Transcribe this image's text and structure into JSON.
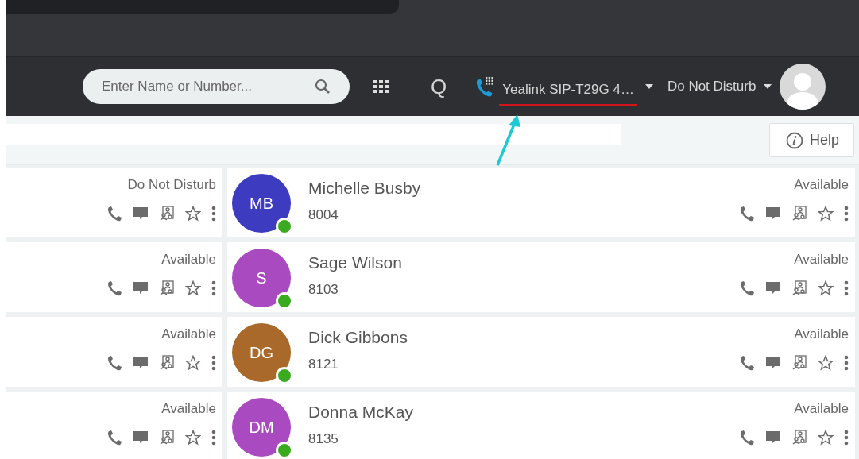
{
  "header": {
    "search": {
      "placeholder": "Enter Name or Number..."
    },
    "q_label": "Q",
    "device": {
      "label": "Yealink SIP-T29G 4…"
    },
    "status_menu": {
      "label": "Do Not Disturb"
    }
  },
  "help_button": {
    "label": "Help"
  },
  "rows": [
    {
      "left": {
        "status": "Do Not Disturb"
      },
      "right": {
        "avatar": {
          "initials": "MB",
          "color": "#3d3bbf"
        },
        "presence": {
          "color": "#3aaa1f"
        },
        "name": "Michelle Busby",
        "extension": "8004",
        "status": "Available"
      }
    },
    {
      "left": {
        "status": "Available"
      },
      "right": {
        "avatar": {
          "initials": "S",
          "color": "#a94ac0"
        },
        "presence": {
          "color": "#3aaa1f"
        },
        "name": "Sage Wilson",
        "extension": "8103",
        "status": "Available"
      }
    },
    {
      "left": {
        "status": "Available"
      },
      "right": {
        "avatar": {
          "initials": "DG",
          "color": "#a8692a"
        },
        "presence": {
          "color": "#3aaa1f"
        },
        "name": "Dick Gibbons",
        "extension": "8121",
        "status": "Available"
      }
    },
    {
      "left": {
        "status": "Available"
      },
      "right": {
        "avatar": {
          "initials": "DM",
          "color": "#a94ac0"
        },
        "presence": {
          "color": "#3aaa1f"
        },
        "name": "Donna McKay",
        "extension": "8135",
        "status": "Available"
      }
    }
  ]
}
